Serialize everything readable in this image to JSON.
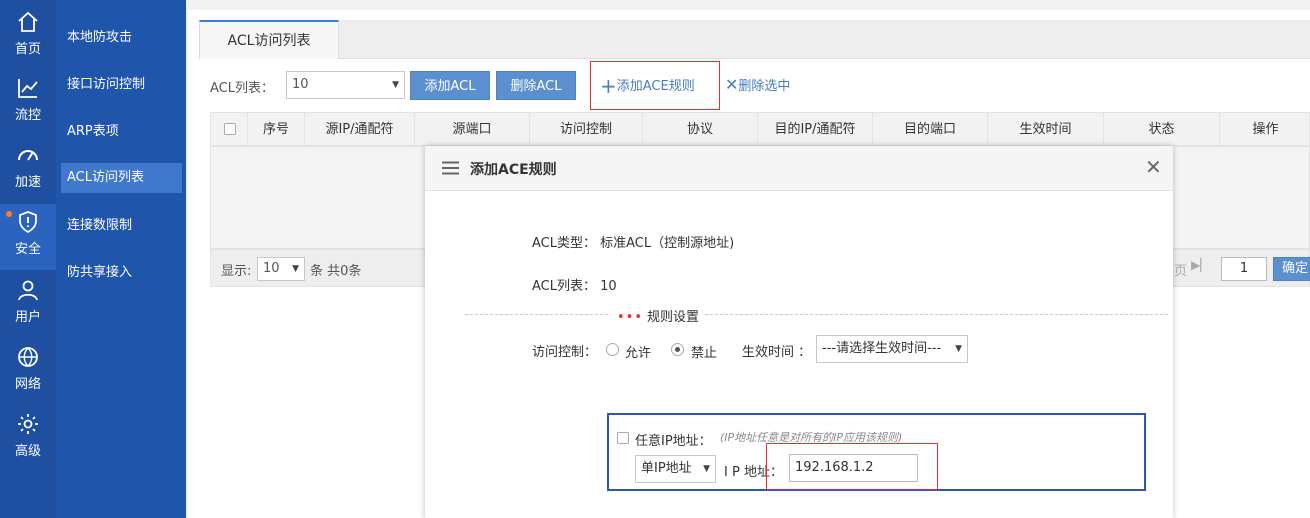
{
  "nav": {
    "rail": [
      {
        "label": "首页",
        "icon": "home-icon"
      },
      {
        "label": "流控",
        "icon": "chart-line-icon"
      },
      {
        "label": "加速",
        "icon": "speedometer-icon"
      },
      {
        "label": "安全",
        "icon": "shield-alert-icon",
        "active": true
      },
      {
        "label": "用户",
        "icon": "user-icon"
      },
      {
        "label": "网络",
        "icon": "globe-icon"
      },
      {
        "label": "高级",
        "icon": "gear-icon"
      }
    ],
    "submenu": [
      "本地防攻击",
      "接口访问控制",
      "ARP表项",
      "ACL访问列表",
      "连接数限制",
      "防共享接入"
    ]
  },
  "tab": {
    "label": "ACL访问列表"
  },
  "toolbar": {
    "acl_label": "ACL列表：",
    "acl_value": "10",
    "add_acl": "添加ACL",
    "delete_acl": "删除ACL",
    "add_ace": "添加ACE规则",
    "delete_selected": "删除选中"
  },
  "table": {
    "columns": [
      "序号",
      "源IP/通配符",
      "源端口",
      "访问控制",
      "协议",
      "目的IP/通配符",
      "目的端口",
      "生效时间",
      "状态",
      "操作"
    ]
  },
  "pager": {
    "show_label": "显示:",
    "page_size": "10",
    "summary": "条 共0条",
    "prev_label": "页",
    "page_input": "1",
    "confirm": "确定"
  },
  "modal": {
    "title": "添加ACE规则",
    "acl_type_label": "ACL类型：",
    "acl_type_value": "标准ACL（控制源地址)",
    "acl_list_label": "ACL列表：",
    "acl_list_value": "10",
    "section_title": "规则设置",
    "access_label": "访问控制：",
    "allow": "允许",
    "deny": "禁止",
    "time_label": "生效时间 ：",
    "time_value": "---请选择生效时间---",
    "any_ip_label": "任意IP地址：",
    "any_ip_hint": "(IP地址任意是对所有的IP应用该规则)",
    "ip_type_value": "单IP地址",
    "ip_label": "I P 地址：",
    "ip_value": "192.168.1.2"
  },
  "colors": {
    "rail": "#1e4fa0",
    "submenu": "#1f56ac",
    "accent": "#5b8fd0",
    "highlight": "#e03030"
  }
}
